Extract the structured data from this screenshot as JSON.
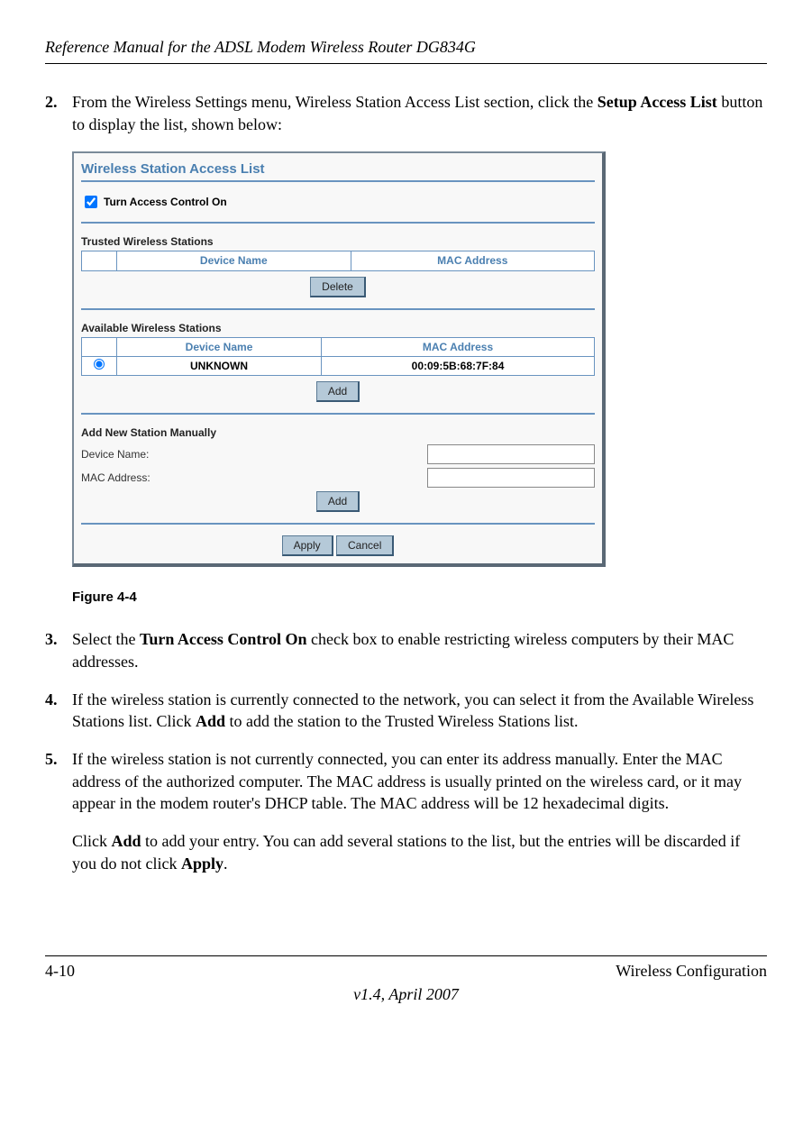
{
  "header": {
    "title": "Reference Manual for the ADSL Modem Wireless Router DG834G"
  },
  "step2": {
    "num": "2.",
    "prefix": "From the Wireless Settings menu, Wireless Station Access List section, click the ",
    "bold1": "Setup Access List",
    "suffix": " button to display the list, shown below:"
  },
  "capture": {
    "title": "Wireless Station Access List",
    "checkboxLabel": "Turn Access Control On",
    "trusted": {
      "title": "Trusted Wireless Stations",
      "col1": "Device Name",
      "col2": "MAC Address",
      "deleteBtn": "Delete"
    },
    "available": {
      "title": "Available Wireless Stations",
      "col1": "Device Name",
      "col2": "MAC Address",
      "row": {
        "name": "UNKNOWN",
        "mac": "00:09:5B:68:7F:84"
      },
      "addBtn": "Add"
    },
    "manual": {
      "title": "Add New Station Manually",
      "deviceLabel": "Device Name:",
      "macLabel": "MAC Address:",
      "addBtn": "Add"
    },
    "applyBtn": "Apply",
    "cancelBtn": "Cancel"
  },
  "figureCaption": "Figure 4-4",
  "step3": {
    "num": "3.",
    "prefix": "Select the ",
    "bold": "Turn Access Control On",
    "suffix": " check box to enable restricting wireless computers by their MAC addresses."
  },
  "step4": {
    "num": "4.",
    "prefix": "If the wireless station is currently connected to the network, you can select it from the Available Wireless Stations list. Click ",
    "bold": "Add",
    "suffix": " to add the station to the Trusted Wireless Stations list."
  },
  "step5": {
    "num": "5.",
    "text": "If the wireless station is not currently connected, you can enter its address manually. Enter the MAC address of the authorized computer. The MAC address is usually printed on the wireless card, or it may appear in the modem router's DHCP table. The MAC address will be 12 hexadecimal digits."
  },
  "step5after": {
    "prefix": "Click ",
    "bold1": "Add",
    "mid": " to add your entry. You can add several stations to the list, but the entries will be discarded if you do not click ",
    "bold2": "Apply",
    "suffix": "."
  },
  "footer": {
    "pageNum": "4-10",
    "sectionTitle": "Wireless Configuration",
    "version": "v1.4, April 2007"
  }
}
